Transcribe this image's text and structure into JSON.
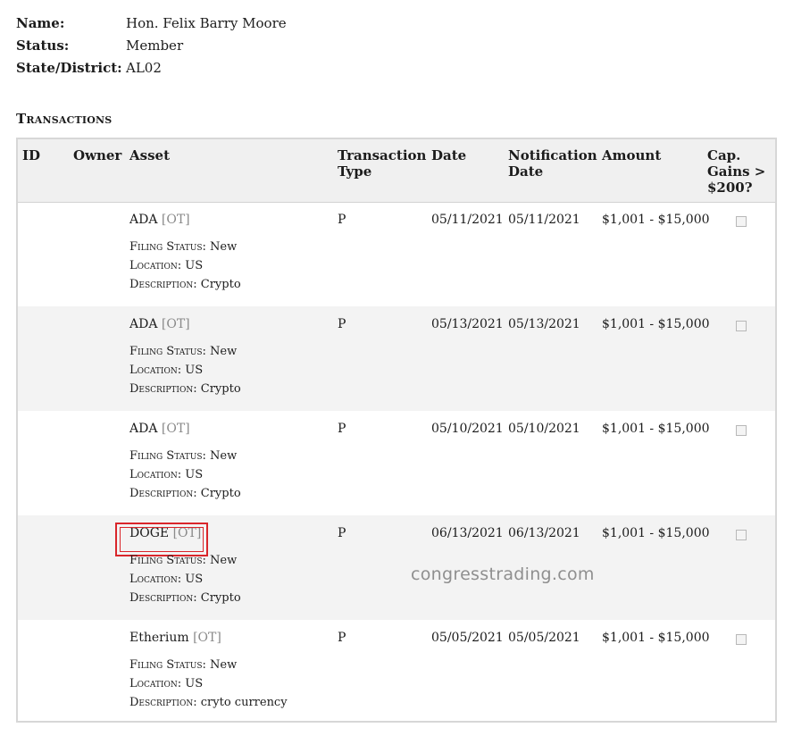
{
  "member": {
    "name_label": "Name:",
    "name_value": "Hon. Felix Barry Moore",
    "status_label": "Status:",
    "status_value": "Member",
    "district_label": "State/District:",
    "district_value": "AL02"
  },
  "section_title": "Transactions",
  "table": {
    "headers": {
      "id": "ID",
      "owner": "Owner",
      "asset": "Asset",
      "type_1": "Transaction",
      "type_2": "Type",
      "date": "Date",
      "notif_1": "Notification",
      "notif_2": "Date",
      "amount": "Amount",
      "cap_1": "Cap.",
      "cap_2": "Gains >",
      "cap_3": "$200?"
    },
    "filing_status_label": "Filing Status:",
    "location_label": "Location:",
    "description_label": "Description:",
    "rows": [
      {
        "asset": "ADA",
        "tag": "[OT]",
        "filing_status": "New",
        "location": "US",
        "description": "Crypto",
        "type": "P",
        "date": "05/11/2021",
        "notification_date": "05/11/2021",
        "amount": "$1,001 - $15,000",
        "cap_gains": false
      },
      {
        "asset": "ADA",
        "tag": "[OT]",
        "filing_status": "New",
        "location": "US",
        "description": "Crypto",
        "type": "P",
        "date": "05/13/2021",
        "notification_date": "05/13/2021",
        "amount": "$1,001 - $15,000",
        "cap_gains": false
      },
      {
        "asset": "ADA",
        "tag": "[OT]",
        "filing_status": "New",
        "location": "US",
        "description": "Crypto",
        "type": "P",
        "date": "05/10/2021",
        "notification_date": "05/10/2021",
        "amount": "$1,001 - $15,000",
        "cap_gains": false
      },
      {
        "asset": "DOGE",
        "tag": "[OT]",
        "filing_status": "New",
        "location": "US",
        "description": "Crypto",
        "type": "P",
        "date": "06/13/2021",
        "notification_date": "06/13/2021",
        "amount": "$1,001 - $15,000",
        "cap_gains": false,
        "highlighted": true
      },
      {
        "asset": "Etherium",
        "tag": "[OT]",
        "filing_status": "New",
        "location": "US",
        "description": "cryto currency",
        "type": "P",
        "date": "05/05/2021",
        "notification_date": "05/05/2021",
        "amount": "$1,001 - $15,000",
        "cap_gains": false
      }
    ]
  },
  "watermark": "congresstrading.com",
  "colors": {
    "highlight": "#d9262b",
    "header_bg": "#f0f0f0",
    "alt_row_bg": "#f3f3f3",
    "tag": "#8a8a8a"
  }
}
